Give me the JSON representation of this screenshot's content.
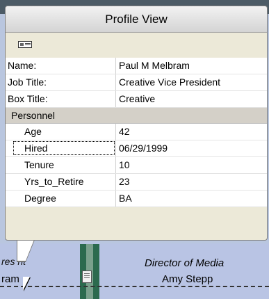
{
  "popup": {
    "title": "Profile View",
    "toolbar_icon": "card-icon",
    "fields": [
      {
        "label": "Name:",
        "value": "Paul M Melbram"
      },
      {
        "label": "Job Title:",
        "value": "Creative Vice President"
      },
      {
        "label": "Box Title:",
        "value": "Creative"
      }
    ],
    "category": "Personnel",
    "personnel": [
      {
        "label": "Age",
        "value": "42"
      },
      {
        "label": "Hired",
        "value": "06/29/1999"
      },
      {
        "label": "Tenure",
        "value": "10"
      },
      {
        "label": "Yrs_to_Retire",
        "value": "23"
      },
      {
        "label": "Degree",
        "value": "BA"
      }
    ]
  },
  "background": {
    "left_title_fragment": "res   nt",
    "left_name_fragment": "ram",
    "right_title": "Director of Media",
    "right_name": "Amy Stepp"
  }
}
